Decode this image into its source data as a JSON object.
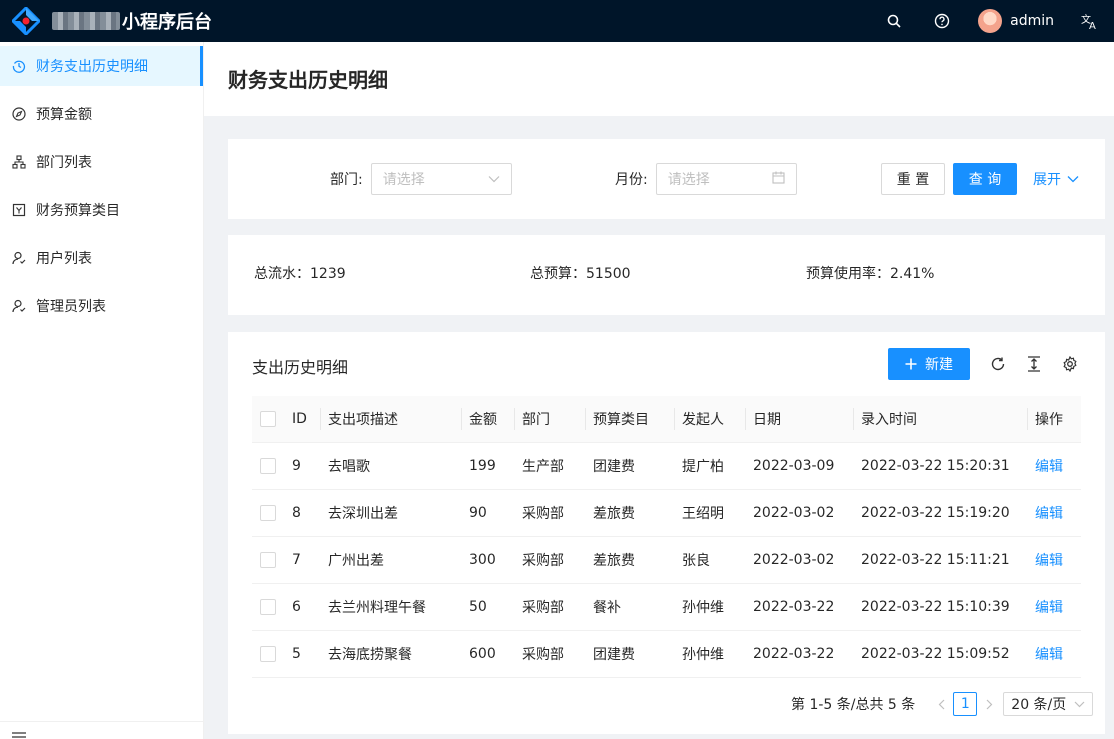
{
  "header": {
    "app_title": "小程序后台",
    "username": "admin",
    "colors": {
      "background": "#001529",
      "accent": "#1890ff"
    }
  },
  "sidebar": {
    "items": [
      {
        "label": "财务支出历史明细",
        "icon": "history-icon",
        "active": true
      },
      {
        "label": "预算金额",
        "icon": "compass-icon",
        "active": false
      },
      {
        "label": "部门列表",
        "icon": "cluster-icon",
        "active": false
      },
      {
        "label": "财务预算类目",
        "icon": "category-icon",
        "active": false
      },
      {
        "label": "用户列表",
        "icon": "user-icon",
        "active": false
      },
      {
        "label": "管理员列表",
        "icon": "user-icon",
        "active": false
      }
    ]
  },
  "page": {
    "title": "财务支出历史明细"
  },
  "filter": {
    "dept_label": "部门:",
    "dept_placeholder": "请选择",
    "month_label": "月份:",
    "month_placeholder": "请选择",
    "reset_label": "重 置",
    "query_label": "查 询",
    "expand_label": "展开"
  },
  "stats": {
    "total_flow": "总流水：1239",
    "total_budget": "总预算：51500",
    "usage_rate": "预算使用率：2.41%"
  },
  "table": {
    "title": "支出历史明细",
    "new_label": "新建",
    "columns": [
      "ID",
      "支出项描述",
      "金额",
      "部门",
      "预算类目",
      "发起人",
      "日期",
      "录入时间",
      "操作"
    ],
    "rows": [
      {
        "id": "9",
        "desc": "去唱歌",
        "amount": "199",
        "dept": "生产部",
        "category": "团建费",
        "initiator": "提广柏",
        "date": "2022-03-09",
        "entry_time": "2022-03-22 15:20:31",
        "action": "编辑"
      },
      {
        "id": "8",
        "desc": "去深圳出差",
        "amount": "90",
        "dept": "采购部",
        "category": "差旅费",
        "initiator": "王绍明",
        "date": "2022-03-02",
        "entry_time": "2022-03-22 15:19:20",
        "action": "编辑"
      },
      {
        "id": "7",
        "desc": "广州出差",
        "amount": "300",
        "dept": "采购部",
        "category": "差旅费",
        "initiator": "张良",
        "date": "2022-03-02",
        "entry_time": "2022-03-22 15:11:21",
        "action": "编辑"
      },
      {
        "id": "6",
        "desc": "去兰州料理午餐",
        "amount": "50",
        "dept": "采购部",
        "category": "餐补",
        "initiator": "孙仲维",
        "date": "2022-03-22",
        "entry_time": "2022-03-22 15:10:39",
        "action": "编辑"
      },
      {
        "id": "5",
        "desc": "去海底捞聚餐",
        "amount": "600",
        "dept": "采购部",
        "category": "团建费",
        "initiator": "孙仲维",
        "date": "2022-03-22",
        "entry_time": "2022-03-22 15:09:52",
        "action": "编辑"
      }
    ]
  },
  "pagination": {
    "summary": "第 1-5 条/总共 5 条",
    "current_page": "1",
    "page_size": "20 条/页"
  }
}
